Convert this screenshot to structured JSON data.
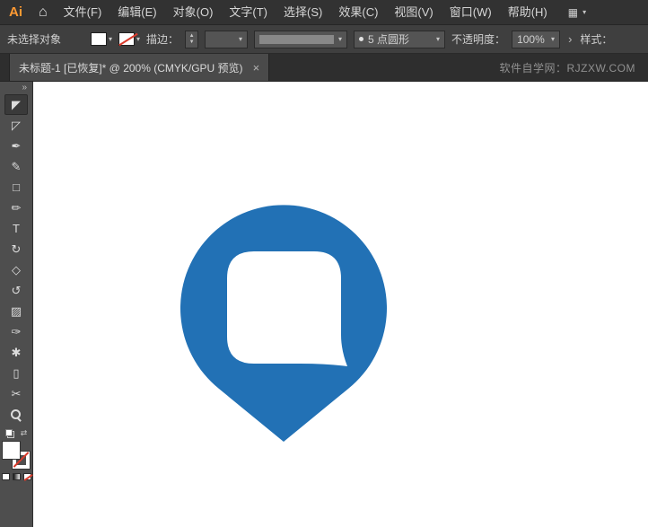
{
  "app": {
    "logo": "Ai"
  },
  "colors": {
    "pin_blue": "#2271b5",
    "bubble_white": "#ffffff",
    "accent_red": "#d93a2b",
    "logo_orange": "#ff9a33"
  },
  "icons": {
    "home": "⌂",
    "workspace": "▦",
    "chevron_down": "▾",
    "step_up": "▲",
    "step_down": "▼",
    "expand": "›",
    "collapse": "»",
    "swap": "⇄"
  },
  "menu": {
    "items": [
      "文件(F)",
      "编辑(E)",
      "对象(O)",
      "文字(T)",
      "选择(S)",
      "效果(C)",
      "视图(V)",
      "窗口(W)",
      "帮助(H)"
    ]
  },
  "control": {
    "status": "未选择对象",
    "stroke_label": "描边：",
    "brush_name": "5 点圆形",
    "opacity_label": "不透明度：",
    "opacity_value": "100%",
    "style_label": "样式："
  },
  "tab": {
    "title": "未标题-1 [已恢复]* @ 200% (CMYK/GPU 预览)",
    "close_glyph": "×",
    "promo": "软件自学网：RJZXW.COM"
  },
  "toolbar": {
    "tools": [
      {
        "name": "selection-tool",
        "glyph": "◤",
        "active": true
      },
      {
        "name": "direct-selection-tool",
        "glyph": "◸"
      },
      {
        "name": "pen-tool",
        "glyph": "✒"
      },
      {
        "name": "pencil-tool",
        "glyph": "✎"
      },
      {
        "name": "rectangle-tool",
        "glyph": "□"
      },
      {
        "name": "paintbrush-tool",
        "glyph": "✏"
      },
      {
        "name": "type-tool",
        "glyph": "T"
      },
      {
        "name": "rotate-tool",
        "glyph": "↻"
      },
      {
        "name": "eraser-tool",
        "glyph": "◇"
      },
      {
        "name": "rotate-view-tool",
        "glyph": "↺"
      },
      {
        "name": "gradient-tool",
        "glyph": "▨"
      },
      {
        "name": "eyedropper-tool",
        "glyph": "✑"
      },
      {
        "name": "symbol-sprayer-tool",
        "glyph": "✱"
      },
      {
        "name": "artboard-tool",
        "glyph": "▯"
      },
      {
        "name": "slice-tool",
        "glyph": "✂"
      },
      {
        "name": "zoom-tool",
        "shape": "magnifier"
      }
    ]
  }
}
